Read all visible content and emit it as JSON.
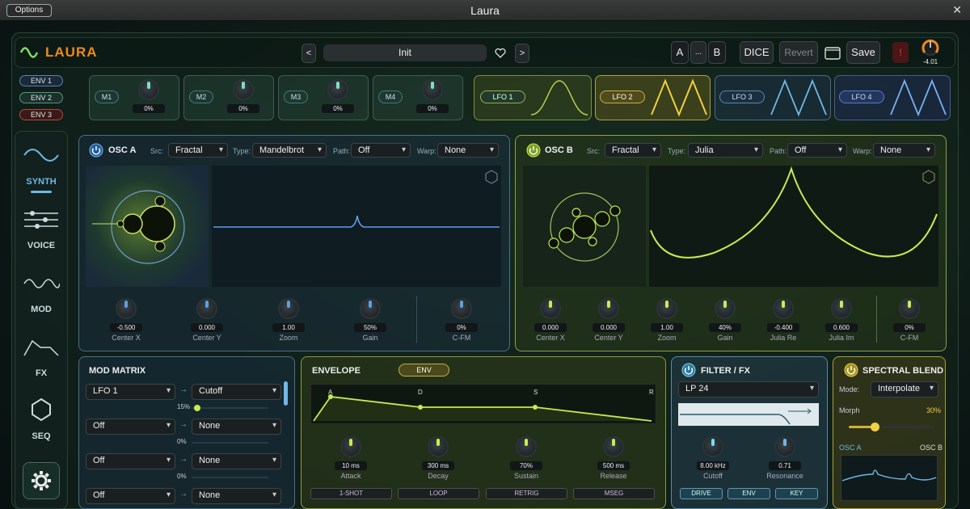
{
  "window": {
    "title": "Laura",
    "options_label": "Options",
    "close_glyph": "✕"
  },
  "header": {
    "logo": "LAURA",
    "prev": "<",
    "next": ">",
    "preset": "Init",
    "a": "A",
    "ab_more": "...",
    "b": "B",
    "dice": "DICE",
    "revert": "Revert",
    "save": "Save",
    "alert": "!",
    "master_value": "-4.01"
  },
  "env_list": [
    "ENV 1",
    "ENV 2",
    "ENV 3"
  ],
  "macros": [
    {
      "label": "M1",
      "value": "0%"
    },
    {
      "label": "M2",
      "value": "0%"
    },
    {
      "label": "M3",
      "value": "0%"
    },
    {
      "label": "M4",
      "value": "0%"
    }
  ],
  "lfos": [
    {
      "label": "LFO 1"
    },
    {
      "label": "LFO 2"
    },
    {
      "label": "LFO 3"
    },
    {
      "label": "LFO 4"
    }
  ],
  "sidebar": [
    {
      "label": "SYNTH"
    },
    {
      "label": "VOICE"
    },
    {
      "label": "MOD"
    },
    {
      "label": "FX"
    },
    {
      "label": "SEQ"
    }
  ],
  "osc_a": {
    "title": "OSC A",
    "src_label": "Src:",
    "src": "Fractal",
    "type_label": "Type:",
    "type": "Mandelbrot",
    "path_label": "Path:",
    "path": "Off",
    "warp_label": "Warp:",
    "warp": "None",
    "knobs": [
      {
        "value": "-0.500",
        "name": "Center X"
      },
      {
        "value": "0.000",
        "name": "Center Y"
      },
      {
        "value": "1.00",
        "name": "Zoom"
      },
      {
        "value": "50%",
        "name": "Gain"
      },
      {
        "value": "0%",
        "name": "C-FM"
      }
    ]
  },
  "osc_b": {
    "title": "OSC B",
    "src_label": "Src:",
    "src": "Fractal",
    "type_label": "Type:",
    "type": "Julia",
    "path_label": "Path:",
    "path": "Off",
    "warp_label": "Warp:",
    "warp": "None",
    "knobs": [
      {
        "value": "0.000",
        "name": "Center X"
      },
      {
        "value": "0.000",
        "name": "Center Y"
      },
      {
        "value": "1.00",
        "name": "Zoom"
      },
      {
        "value": "40%",
        "name": "Gain"
      },
      {
        "value": "-0.400",
        "name": "Julia Re"
      },
      {
        "value": "0.600",
        "name": "Julia Im"
      },
      {
        "value": "0%",
        "name": "C-FM"
      }
    ]
  },
  "mod_matrix": {
    "title": "MOD MATRIX",
    "rows": [
      {
        "source": "LFO 1",
        "dest": "Cutoff",
        "amount": "15%"
      },
      {
        "source": "Off",
        "dest": "None",
        "amount": "0%"
      },
      {
        "source": "Off",
        "dest": "None",
        "amount": "0%"
      },
      {
        "source": "Off",
        "dest": "None",
        "amount": ""
      }
    ]
  },
  "envelope": {
    "title": "ENVELOPE",
    "tag": "ENV",
    "points": [
      "A",
      "D",
      "S",
      "R"
    ],
    "knobs": [
      {
        "value": "10 ms",
        "name": "Attack"
      },
      {
        "value": "300 ms",
        "name": "Decay"
      },
      {
        "value": "70%",
        "name": "Sustain"
      },
      {
        "value": "500 ms",
        "name": "Release"
      }
    ],
    "modes": [
      "1-SHOT",
      "LOOP",
      "RETRIG",
      "MSEG"
    ]
  },
  "filter": {
    "title": "FILTER / FX",
    "type": "LP 24",
    "knobs": [
      {
        "value": "8.00 kHz",
        "name": "Cutoff"
      },
      {
        "value": "0.71",
        "name": "Resonance"
      }
    ],
    "buttons": [
      "DRIVE",
      "ENV",
      "KEY"
    ]
  },
  "spectral": {
    "title": "SPECTRAL BLEND",
    "mode_label": "Mode:",
    "mode": "Interpolate",
    "morph_label": "Morph",
    "morph_value": "30%",
    "morph": 0.3,
    "osc_a": "OSC A",
    "osc_b": "OSC B"
  },
  "colors": {
    "accent": "#f08a1c",
    "osc_a": "#5aa0e6",
    "osc_b": "#c8ec50",
    "lfo_yellow": "#f0d040",
    "lfo_blue": "#6fb8e8"
  }
}
